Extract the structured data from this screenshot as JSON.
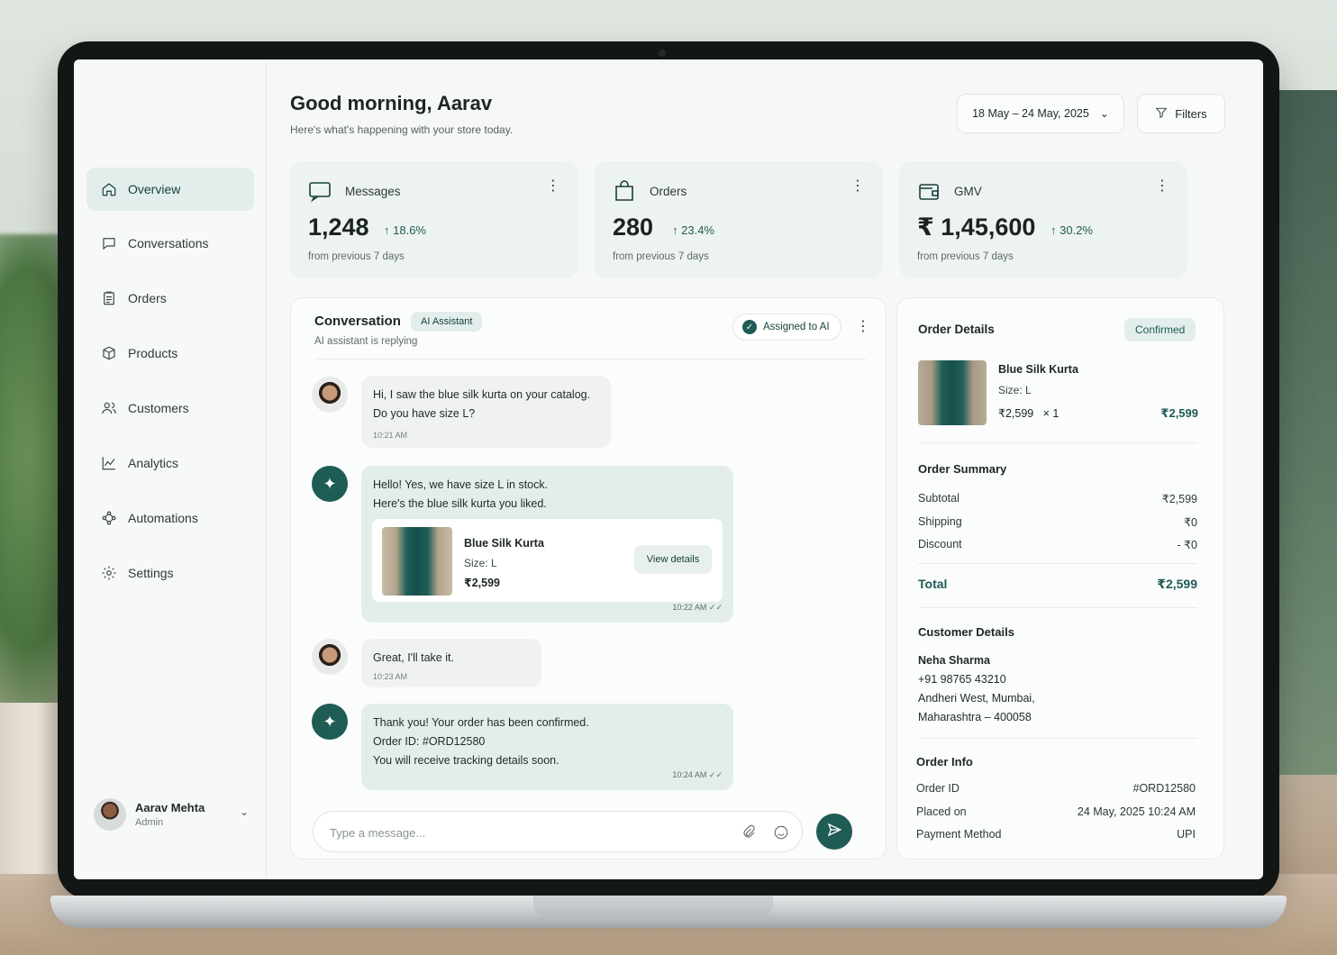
{
  "sidebar": {
    "items": [
      {
        "label": "Overview",
        "icon": "home-icon",
        "active": true
      },
      {
        "label": "Conversations",
        "icon": "chat-icon",
        "active": false
      },
      {
        "label": "Orders",
        "icon": "clipboard-icon",
        "active": false
      },
      {
        "label": "Products",
        "icon": "box-icon",
        "active": false
      },
      {
        "label": "Customers",
        "icon": "users-icon",
        "active": false
      },
      {
        "label": "Analytics",
        "icon": "chart-icon",
        "active": false
      },
      {
        "label": "Automations",
        "icon": "nodes-icon",
        "active": false
      },
      {
        "label": "Settings",
        "icon": "gear-icon",
        "active": false
      }
    ],
    "user": {
      "name": "Aarav Mehta",
      "role": "Admin"
    }
  },
  "header": {
    "greeting": "Good morning, Aarav",
    "subtitle": "Here's what's happening with your store today.",
    "date_range": "18 May – 24 May, 2025",
    "filters_label": "Filters"
  },
  "stats": [
    {
      "label": "Messages",
      "value": "1,248",
      "change": "18.6%",
      "foot": "from previous 7 days",
      "icon": "message-icon"
    },
    {
      "label": "Orders",
      "value": "280",
      "change": "23.4%",
      "foot": "from previous 7 days",
      "icon": "bag-icon"
    },
    {
      "label": "GMV",
      "value": "₹ 1,45,600",
      "change": "30.2%",
      "foot": "from previous 7 days",
      "icon": "wallet-icon"
    }
  ],
  "conversation": {
    "title": "Conversation",
    "badge": "AI Assistant",
    "status": "AI assistant is replying",
    "assigned": "Assigned to AI",
    "messages": [
      {
        "from": "customer",
        "lines": [
          "Hi, I saw the blue silk kurta on your catalog.",
          "Do you have size L?"
        ],
        "time": "10:21 AM"
      },
      {
        "from": "ai",
        "lines": [
          "Hello! Yes, we have size L in stock.",
          "Here's the blue silk kurta you liked."
        ],
        "time": "10:22 AM ✓✓",
        "product": {
          "name": "Blue Silk Kurta",
          "size": "Size: L",
          "price": "₹2,599",
          "button": "View details"
        }
      },
      {
        "from": "customer",
        "lines": [
          "Great, I'll take it."
        ],
        "time": "10:23 AM"
      },
      {
        "from": "ai",
        "lines": [
          "Thank you! Your order has been confirmed.",
          "Order ID: #ORD12580",
          "You will receive tracking details soon."
        ],
        "time": "10:24 AM ✓✓"
      }
    ],
    "input_placeholder": "Type a message..."
  },
  "order": {
    "title": "Order Details",
    "status": "Confirmed",
    "item": {
      "name": "Blue Silk Kurta",
      "size": "Size: L",
      "qty": "₹2,599   × 1",
      "line_total": "₹2,599"
    },
    "summary_title": "Order Summary",
    "summary": [
      {
        "label": "Subtotal",
        "value": "₹2,599"
      },
      {
        "label": "Shipping",
        "value": "₹0"
      },
      {
        "label": "Discount",
        "value": "- ₹0"
      }
    ],
    "total": {
      "label": "Total",
      "value": "₹2,599"
    },
    "customer_title": "Customer Details",
    "customer": {
      "name": "Neha Sharma",
      "phone": "+91 98765 43210",
      "address1": "Andheri West, Mumbai,",
      "address2": "Maharashtra – 400058"
    },
    "info_title": "Order Info",
    "info": [
      {
        "label": "Order ID",
        "value": "#ORD12580"
      },
      {
        "label": "Placed on",
        "value": "24 May, 2025 10:24 AM"
      },
      {
        "label": "Payment Method",
        "value": "UPI"
      }
    ]
  },
  "colors": {
    "accent": "#1e5c55",
    "accent_light": "#e3eeec",
    "card_bg": "#edf3f1"
  }
}
